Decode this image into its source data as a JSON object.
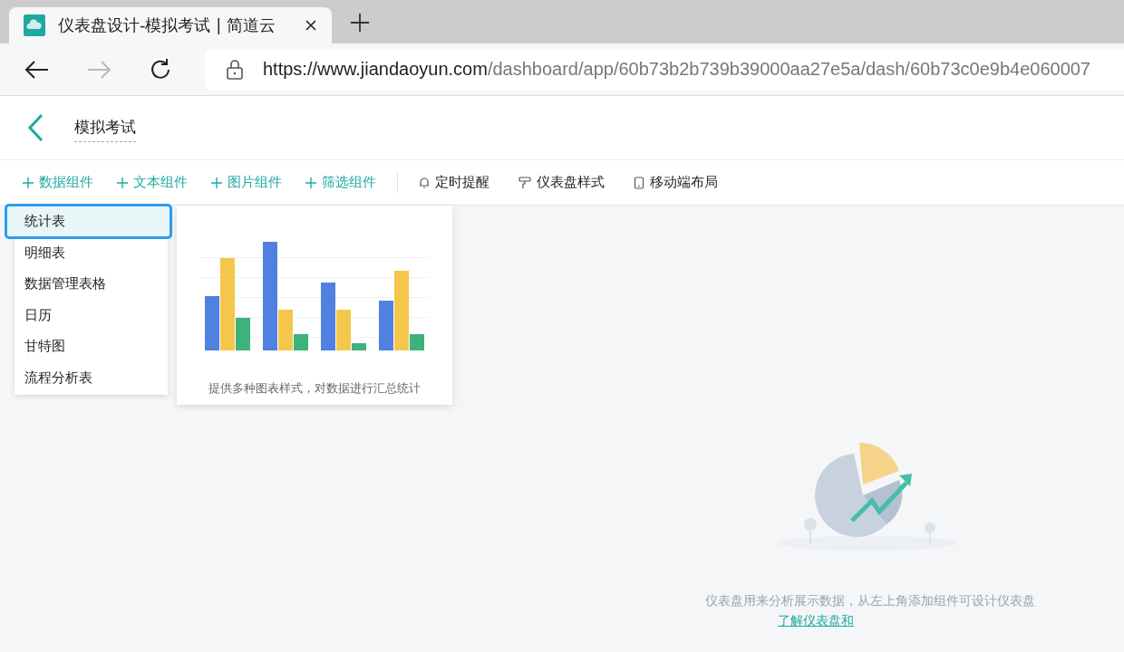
{
  "browser": {
    "tab_title": "仪表盘设计-模拟考试 | 简道云",
    "url_host": "https://www.jiandaoyun.com",
    "url_path": "/dashboard/app/60b73b2b739b39000aa27e5a/dash/60b73c0e9b4e060007"
  },
  "header": {
    "title": "模拟考试"
  },
  "toolbar": [
    {
      "kind": "add",
      "label": "数据组件"
    },
    {
      "kind": "add",
      "label": "文本组件"
    },
    {
      "kind": "add",
      "label": "图片组件"
    },
    {
      "kind": "add",
      "label": "筛选组件"
    },
    {
      "kind": "tool",
      "label": "定时提醒"
    },
    {
      "kind": "tool",
      "label": "仪表盘样式"
    },
    {
      "kind": "tool",
      "label": "移动端布局"
    }
  ],
  "menu": [
    {
      "label": "统计表",
      "selected": true
    },
    {
      "label": "明细表",
      "selected": false
    },
    {
      "label": "数据管理表格",
      "selected": false
    },
    {
      "label": "日历",
      "selected": false
    },
    {
      "label": "甘特图",
      "selected": false
    },
    {
      "label": "流程分析表",
      "selected": false
    }
  ],
  "preview": {
    "caption": "提供多种图表样式，对数据进行汇总统计"
  },
  "empty_state": {
    "message": "仪表盘用来分析展示数据，从左上角添加组件可设计仪表盘",
    "link": "了解仪表盘和"
  }
}
